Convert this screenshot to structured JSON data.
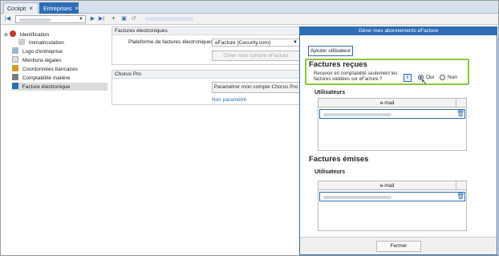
{
  "tabs": [
    {
      "label": "Cockpit"
    },
    {
      "label": "Entreprises"
    }
  ],
  "tree": {
    "items": [
      {
        "label": "Identification"
      },
      {
        "label": "Immatriculation"
      },
      {
        "label": "Logo d'entreprise"
      },
      {
        "label": "Mentions légales"
      },
      {
        "label": "Coordonnées bancaires"
      },
      {
        "label": "Comptabilité matière"
      },
      {
        "label": "Facture électronique"
      }
    ]
  },
  "factures_electroniques": {
    "title": "Factures électroniques",
    "plateforme_label": "Plateforme de factures électroniques",
    "plateforme_value": "eFacture (Cecurity.com)",
    "create_button": "Créer mon compte eFacture"
  },
  "chorus": {
    "title": "Chorus Pro",
    "config_button": "Paramétrer mon compte Chorus Pro",
    "status_link": "Non paramétré"
  },
  "modal": {
    "title": "Gérer mes abonnements eFacture",
    "add_user": "Ajouter utilisateur",
    "recues": {
      "title": "Factures reçues",
      "question": "Recevoir en comptabilité seulement les factures validées sur eFacture ?",
      "oui": "Oui",
      "non": "Non",
      "selected": "Oui",
      "users_title": "Utilisateurs",
      "col_email": "e-mail"
    },
    "emises": {
      "title": "Factures émises",
      "users_title": "Utilisateurs",
      "col_email": "e-mail"
    },
    "close": "Fermer"
  },
  "icons": {
    "info": "info-icon",
    "trash": "trash-icon",
    "close": "close-icon"
  },
  "colors": {
    "accent": "#2d6db5",
    "highlight": "#8dc63f"
  }
}
